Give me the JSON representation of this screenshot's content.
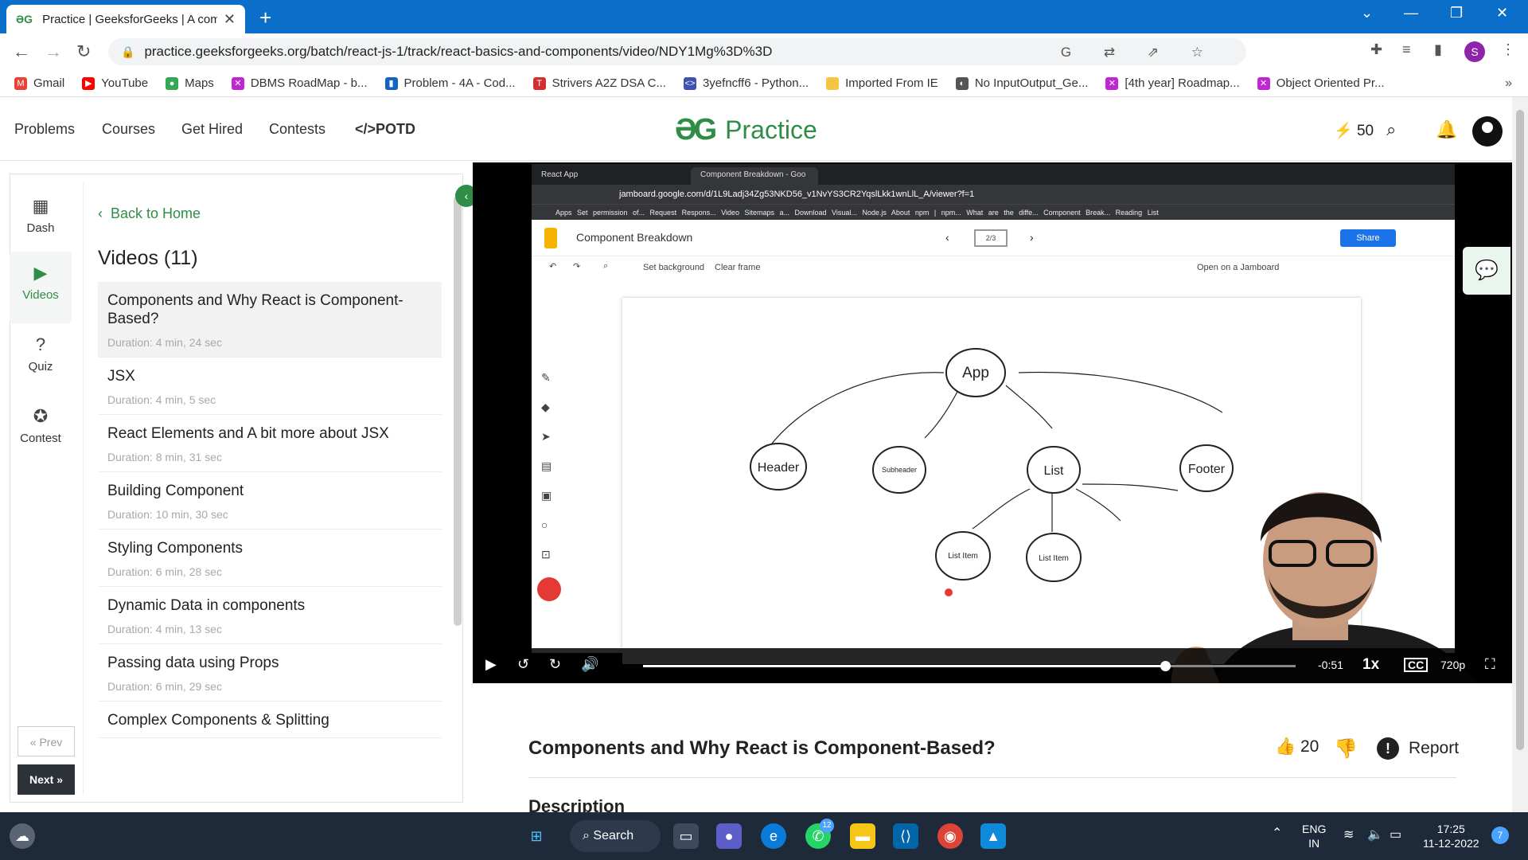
{
  "browser": {
    "tab_title": "Practice | GeeksforGeeks | A com",
    "url": "practice.geeksforgeeks.org/batch/react-js-1/track/react-basics-and-components/video/NDY1Mg%3D%3D",
    "profile_initial": "S",
    "bookmarks": [
      {
        "label": "Gmail",
        "color": "#ea4335",
        "glyph": "M"
      },
      {
        "label": "YouTube",
        "color": "#ff0000",
        "glyph": "▶"
      },
      {
        "label": "Maps",
        "color": "#34a853",
        "glyph": "●"
      },
      {
        "label": "DBMS RoadMap - b...",
        "color": "#c026d3",
        "glyph": "✕"
      },
      {
        "label": "Problem - 4A - Cod...",
        "color": "#1565c0",
        "glyph": "▮"
      },
      {
        "label": "Strivers A2Z DSA C...",
        "color": "#d32f2f",
        "glyph": "T"
      },
      {
        "label": "3yefncff6 - Python...",
        "color": "#3f51b5",
        "glyph": "<>"
      },
      {
        "label": "Imported From IE",
        "color": "#f4c542",
        "glyph": ""
      },
      {
        "label": "No InputOutput_Ge...",
        "color": "#555555",
        "glyph": "◐"
      },
      {
        "label": "[4th year] Roadmap...",
        "color": "#c026d3",
        "glyph": "✕"
      },
      {
        "label": "Object Oriented Pr...",
        "color": "#c026d3",
        "glyph": "✕"
      }
    ]
  },
  "site": {
    "nav": [
      "Problems",
      "Courses",
      "Get Hired",
      "Contests",
      "</>POTD"
    ],
    "logo_text": "Practice",
    "streak": "50"
  },
  "sidebar": {
    "rail": [
      {
        "label": "Dash",
        "icon": "dashboard-icon"
      },
      {
        "label": "Videos",
        "icon": "video-icon"
      },
      {
        "label": "Quiz",
        "icon": "question-icon"
      },
      {
        "label": "Contest",
        "icon": "award-icon"
      }
    ],
    "prev_label": "« Prev",
    "next_label": "Next »",
    "back_label": "Back to Home",
    "videos_title": "Videos (11)",
    "videos": [
      {
        "title": "Components and Why React is Component-Based?",
        "duration": "Duration: 4 min, 24 sec"
      },
      {
        "title": "JSX",
        "duration": "Duration: 4 min, 5 sec"
      },
      {
        "title": "React Elements and A bit more about JSX",
        "duration": "Duration: 8 min, 31 sec"
      },
      {
        "title": "Building Component",
        "duration": "Duration: 10 min, 30 sec"
      },
      {
        "title": "Styling Components",
        "duration": "Duration: 6 min, 28 sec"
      },
      {
        "title": "Dynamic Data in components",
        "duration": "Duration: 4 min, 13 sec"
      },
      {
        "title": "Passing data using Props",
        "duration": "Duration: 6 min, 29 sec"
      },
      {
        "title": "Complex Components & Splitting",
        "duration": ""
      }
    ]
  },
  "video": {
    "inner_tabs": [
      "React App",
      "Component Breakdown - Goo"
    ],
    "inner_url": "jamboard.google.com/d/1L9Ladj34Zg53NKD56_v1NvYS3CR2YqslLkk1wnLlL_A/viewer?f=1",
    "inner_bookmarks": "Apps  Set permission of...  Request Respons...  Video Sitemaps a...  Download Visual...  Node.js  About npm | npm...  What are the diffe...  Component Break...  Reading List",
    "jam_title": "Component Breakdown",
    "frame_indicator": "2/3",
    "share_label": "Share",
    "tool_set_background": "Set background",
    "tool_clear_frame": "Clear frame",
    "open_jamboard": "Open on a Jamboard",
    "diagram_nodes": [
      "App",
      "Header",
      "Subheader",
      "List",
      "Footer",
      "List Item",
      "List Item"
    ],
    "remaining": "-0:51",
    "speed": "1x",
    "cc": "CC",
    "quality": "720p",
    "progress": 0.8
  },
  "lesson": {
    "title": "Components and Why React is Component-Based?",
    "likes": "20",
    "report_label": "Report",
    "description_heading": "Description"
  },
  "taskbar": {
    "search_label": "Search",
    "lang_top": "ENG",
    "lang_bottom": "IN",
    "time": "17:25",
    "date": "11-12-2022",
    "notification_count": "7",
    "whatsapp_badge": "12"
  }
}
